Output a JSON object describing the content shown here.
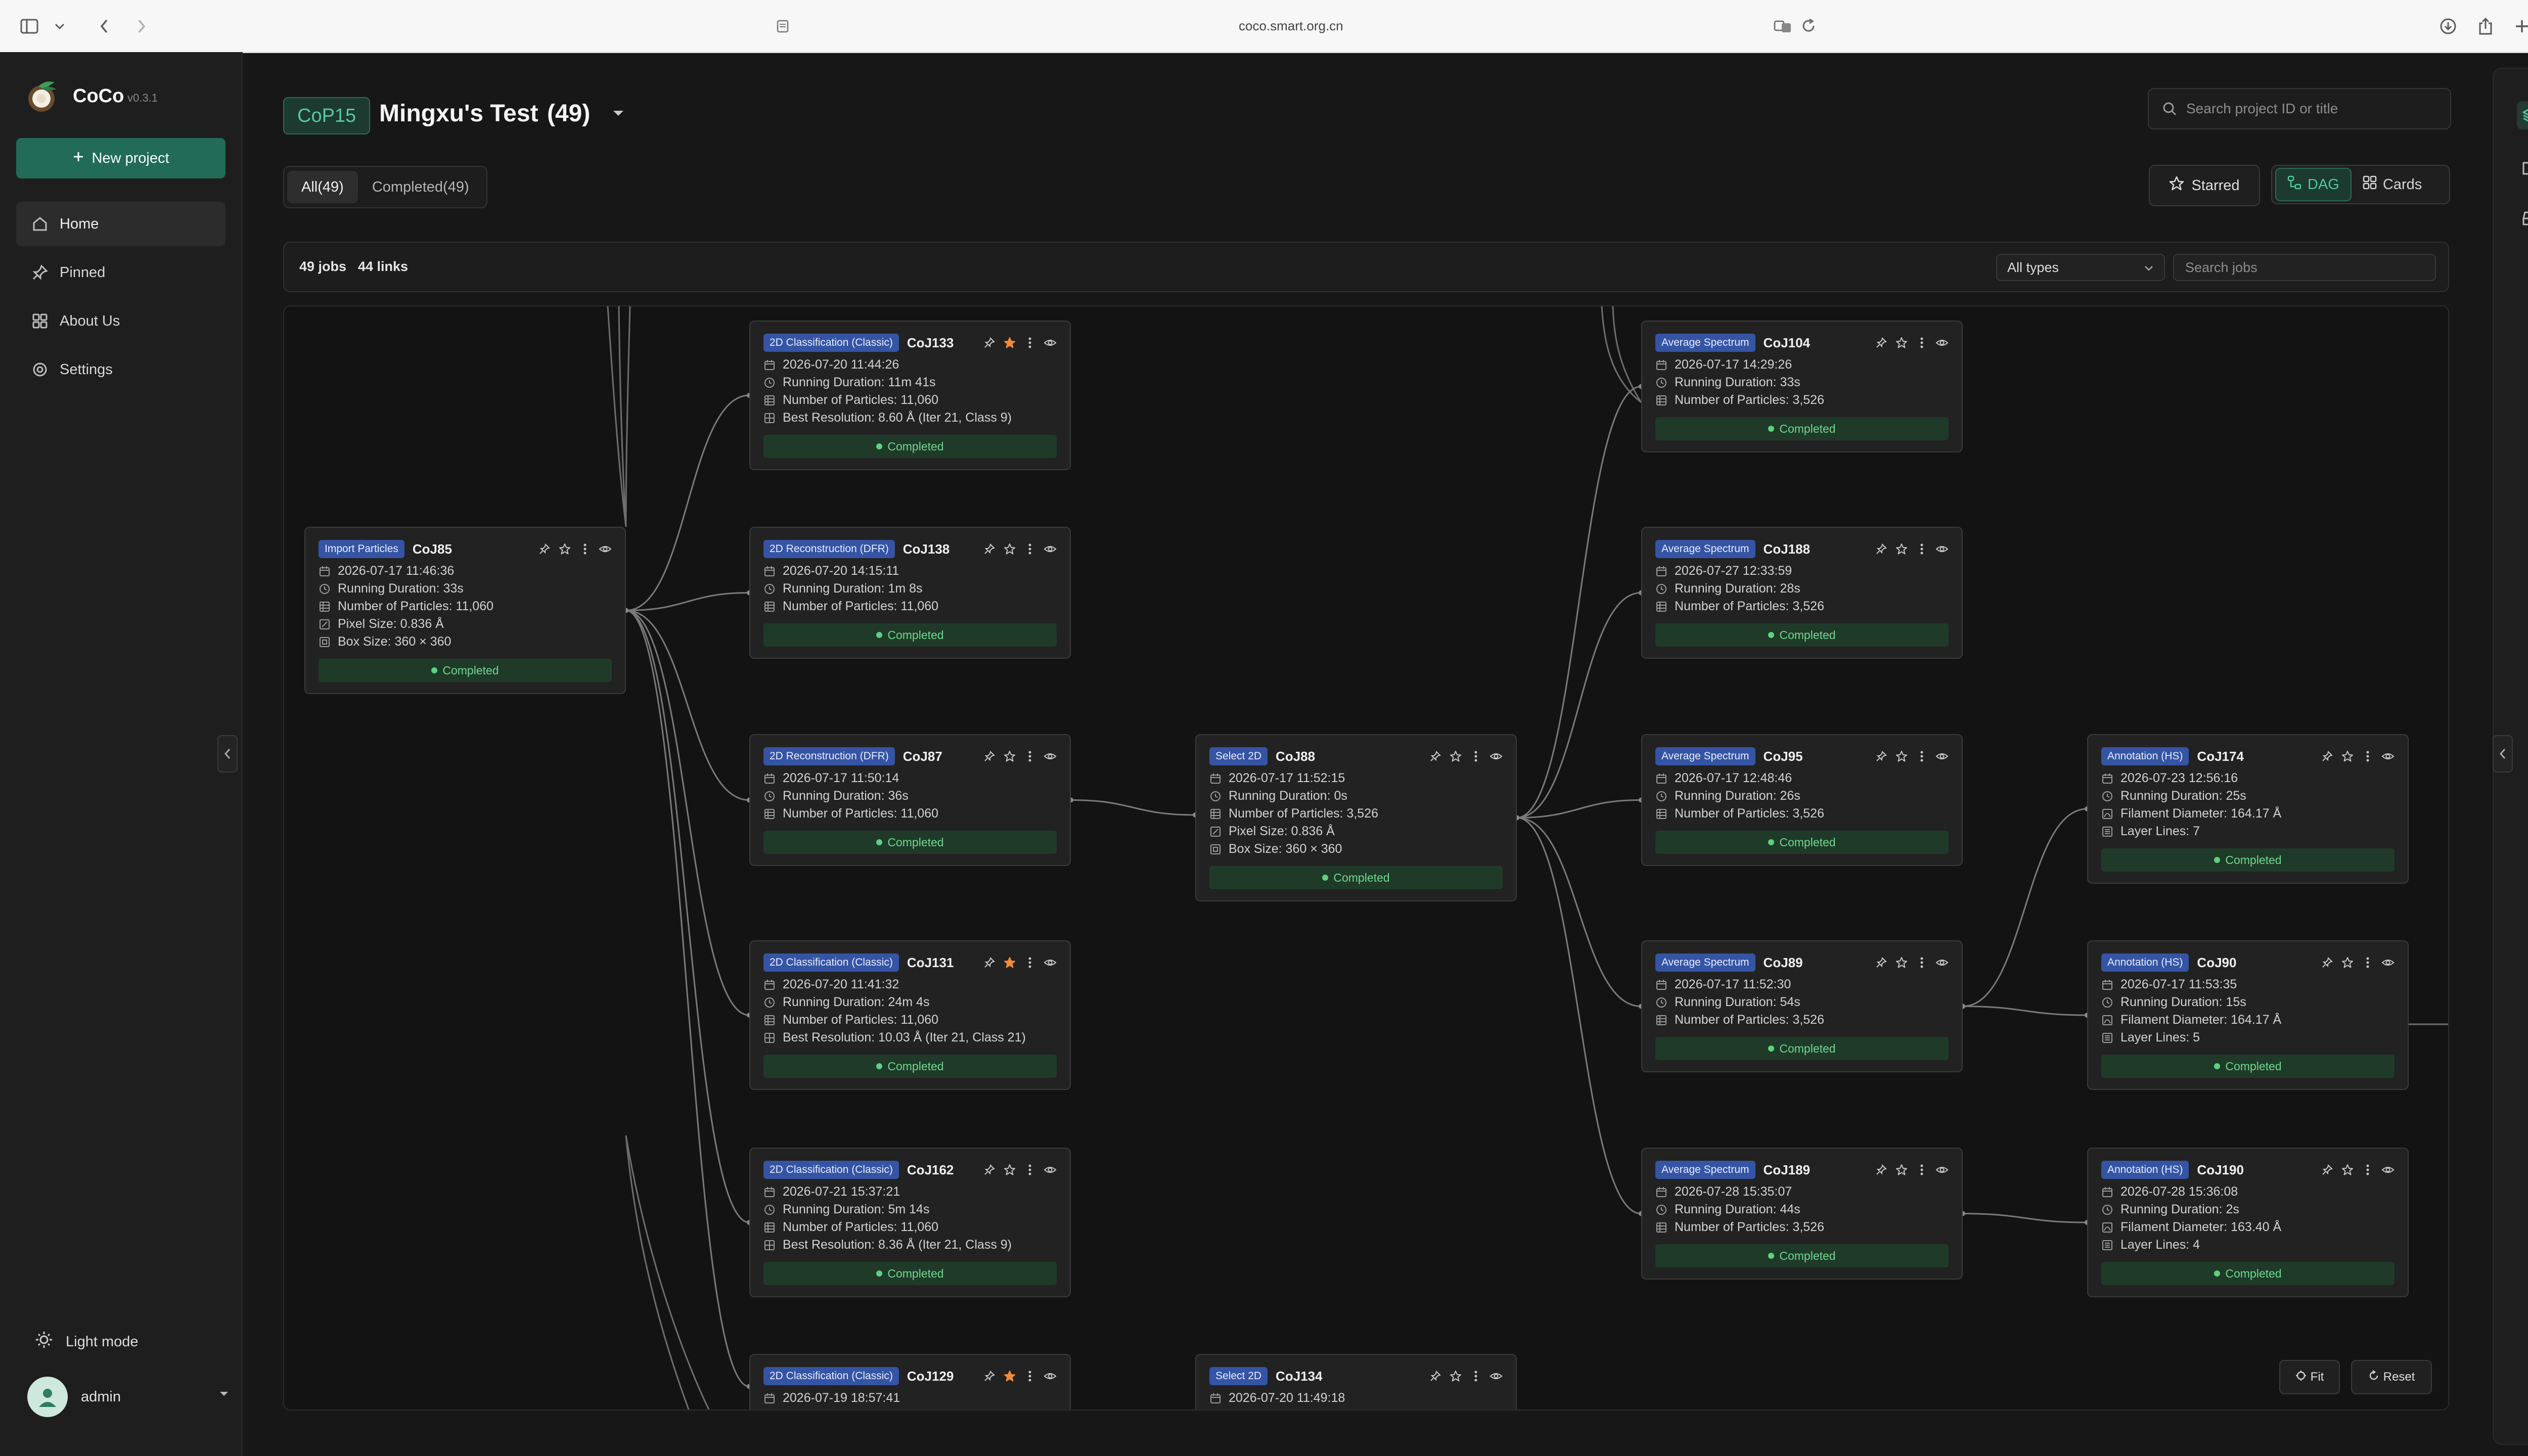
{
  "browser": {
    "url": "coco.smart.org.cn"
  },
  "sidebar": {
    "brand": "CoCo",
    "version": "v0.3.1",
    "new_project": "New project",
    "nav": [
      {
        "label": "Home",
        "icon": "home-icon",
        "active": true
      },
      {
        "label": "Pinned",
        "icon": "pin-icon",
        "active": false
      },
      {
        "label": "About Us",
        "icon": "grid-icon",
        "active": false
      },
      {
        "label": "Settings",
        "icon": "gear-icon",
        "active": false
      }
    ],
    "light_mode": "Light mode",
    "user": "admin"
  },
  "header": {
    "project_code": "CoP15",
    "project_title": "Mingxu's Test",
    "project_count": "(49)",
    "search_placeholder": "Search project ID or title",
    "tabs": [
      {
        "label": "All(49)",
        "active": true
      },
      {
        "label": "Completed(49)",
        "active": false
      }
    ],
    "starred": "Starred",
    "views": [
      {
        "label": "DAG",
        "active": true
      },
      {
        "label": "Cards",
        "active": false
      }
    ]
  },
  "toolbar": {
    "jobs": "49 jobs",
    "links": "44 links",
    "type_filter": "All types",
    "search_placeholder": "Search jobs"
  },
  "canvas": {
    "fit": "Fit",
    "reset": "Reset"
  },
  "colors": {
    "accent": "#226b57",
    "type_badge": "#3554a4",
    "status_green": "#6fd78f",
    "star_orange": "#f08a3c"
  },
  "nodes": [
    {
      "id": "CoJ85",
      "type": "Import Particles",
      "starred": false,
      "status": "Completed",
      "rows": [
        {
          "icon": "calendar-icon",
          "text": "2026-07-17 11:46:36"
        },
        {
          "icon": "clock-icon",
          "text": "Running Duration: 33s"
        },
        {
          "icon": "particles-icon",
          "text": "Number of Particles: 11,060"
        },
        {
          "icon": "ruler-icon",
          "text": "Pixel Size: 0.836 Å"
        },
        {
          "icon": "box-icon",
          "text": "Box Size: 360 × 360"
        }
      ]
    },
    {
      "id": "CoJ133",
      "type": "2D Classification (Classic)",
      "starred": true,
      "status": "Completed",
      "rows": [
        {
          "icon": "calendar-icon",
          "text": "2026-07-20 11:44:26"
        },
        {
          "icon": "clock-icon",
          "text": "Running Duration: 11m 41s"
        },
        {
          "icon": "particles-icon",
          "text": "Number of Particles: 11,060"
        },
        {
          "icon": "resolution-icon",
          "text": "Best Resolution: 8.60 Å (Iter 21, Class 9)"
        }
      ]
    },
    {
      "id": "CoJ138",
      "type": "2D Reconstruction (DFR)",
      "starred": false,
      "status": "Completed",
      "rows": [
        {
          "icon": "calendar-icon",
          "text": "2026-07-20 14:15:11"
        },
        {
          "icon": "clock-icon",
          "text": "Running Duration: 1m 8s"
        },
        {
          "icon": "particles-icon",
          "text": "Number of Particles: 11,060"
        }
      ]
    },
    {
      "id": "CoJ87",
      "type": "2D Reconstruction (DFR)",
      "starred": false,
      "status": "Completed",
      "rows": [
        {
          "icon": "calendar-icon",
          "text": "2026-07-17 11:50:14"
        },
        {
          "icon": "clock-icon",
          "text": "Running Duration: 36s"
        },
        {
          "icon": "particles-icon",
          "text": "Number of Particles: 11,060"
        }
      ]
    },
    {
      "id": "CoJ131",
      "type": "2D Classification (Classic)",
      "starred": true,
      "status": "Completed",
      "rows": [
        {
          "icon": "calendar-icon",
          "text": "2026-07-20 11:41:32"
        },
        {
          "icon": "clock-icon",
          "text": "Running Duration: 24m 4s"
        },
        {
          "icon": "particles-icon",
          "text": "Number of Particles: 11,060"
        },
        {
          "icon": "resolution-icon",
          "text": "Best Resolution: 10.03 Å (Iter 21, Class 21)"
        }
      ]
    },
    {
      "id": "CoJ162",
      "type": "2D Classification (Classic)",
      "starred": false,
      "status": "Completed",
      "rows": [
        {
          "icon": "calendar-icon",
          "text": "2026-07-21 15:37:21"
        },
        {
          "icon": "clock-icon",
          "text": "Running Duration: 5m 14s"
        },
        {
          "icon": "particles-icon",
          "text": "Number of Particles: 11,060"
        },
        {
          "icon": "resolution-icon",
          "text": "Best Resolution: 8.36 Å (Iter 21, Class 9)"
        }
      ]
    },
    {
      "id": "CoJ129",
      "type": "2D Classification (Classic)",
      "starred": true,
      "status": "",
      "rows": [
        {
          "icon": "calendar-icon",
          "text": "2026-07-19 18:57:41"
        }
      ]
    },
    {
      "id": "CoJ88",
      "type": "Select 2D",
      "starred": false,
      "status": "Completed",
      "rows": [
        {
          "icon": "calendar-icon",
          "text": "2026-07-17 11:52:15"
        },
        {
          "icon": "clock-icon",
          "text": "Running Duration: 0s"
        },
        {
          "icon": "particles-icon",
          "text": "Number of Particles: 3,526"
        },
        {
          "icon": "ruler-icon",
          "text": "Pixel Size: 0.836 Å"
        },
        {
          "icon": "box-icon",
          "text": "Box Size: 360 × 360"
        }
      ]
    },
    {
      "id": "CoJ134",
      "type": "Select 2D",
      "starred": false,
      "status": "",
      "rows": [
        {
          "icon": "calendar-icon",
          "text": "2026-07-20 11:49:18"
        }
      ]
    },
    {
      "id": "CoJ104",
      "type": "Average Spectrum",
      "starred": false,
      "status": "Completed",
      "rows": [
        {
          "icon": "calendar-icon",
          "text": "2026-07-17 14:29:26"
        },
        {
          "icon": "clock-icon",
          "text": "Running Duration: 33s"
        },
        {
          "icon": "particles-icon",
          "text": "Number of Particles: 3,526"
        }
      ]
    },
    {
      "id": "CoJ188",
      "type": "Average Spectrum",
      "starred": false,
      "status": "Completed",
      "rows": [
        {
          "icon": "calendar-icon",
          "text": "2026-07-27 12:33:59"
        },
        {
          "icon": "clock-icon",
          "text": "Running Duration: 28s"
        },
        {
          "icon": "particles-icon",
          "text": "Number of Particles: 3,526"
        }
      ]
    },
    {
      "id": "CoJ95",
      "type": "Average Spectrum",
      "starred": false,
      "status": "Completed",
      "rows": [
        {
          "icon": "calendar-icon",
          "text": "2026-07-17 12:48:46"
        },
        {
          "icon": "clock-icon",
          "text": "Running Duration: 26s"
        },
        {
          "icon": "particles-icon",
          "text": "Number of Particles: 3,526"
        }
      ]
    },
    {
      "id": "CoJ89",
      "type": "Average Spectrum",
      "starred": false,
      "status": "Completed",
      "rows": [
        {
          "icon": "calendar-icon",
          "text": "2026-07-17 11:52:30"
        },
        {
          "icon": "clock-icon",
          "text": "Running Duration: 54s"
        },
        {
          "icon": "particles-icon",
          "text": "Number of Particles: 3,526"
        }
      ]
    },
    {
      "id": "CoJ189",
      "type": "Average Spectrum",
      "starred": false,
      "status": "Completed",
      "rows": [
        {
          "icon": "calendar-icon",
          "text": "2026-07-28 15:35:07"
        },
        {
          "icon": "clock-icon",
          "text": "Running Duration: 44s"
        },
        {
          "icon": "particles-icon",
          "text": "Number of Particles: 3,526"
        }
      ]
    },
    {
      "id": "CoJ174",
      "type": "Annotation (HS)",
      "starred": false,
      "status": "Completed",
      "rows": [
        {
          "icon": "calendar-icon",
          "text": "2026-07-23 12:56:16"
        },
        {
          "icon": "clock-icon",
          "text": "Running Duration: 25s"
        },
        {
          "icon": "filament-icon",
          "text": "Filament Diameter: 164.17 Å"
        },
        {
          "icon": "layers-icon",
          "text": "Layer Lines: 7"
        }
      ]
    },
    {
      "id": "CoJ90",
      "type": "Annotation (HS)",
      "starred": false,
      "status": "Completed",
      "rows": [
        {
          "icon": "calendar-icon",
          "text": "2026-07-17 11:53:35"
        },
        {
          "icon": "clock-icon",
          "text": "Running Duration: 15s"
        },
        {
          "icon": "filament-icon",
          "text": "Filament Diameter: 164.17 Å"
        },
        {
          "icon": "layers-icon",
          "text": "Layer Lines: 5"
        }
      ]
    },
    {
      "id": "CoJ190",
      "type": "Annotation (HS)",
      "starred": false,
      "status": "Completed",
      "rows": [
        {
          "icon": "calendar-icon",
          "text": "2026-07-28 15:36:08"
        },
        {
          "icon": "clock-icon",
          "text": "Running Duration: 2s"
        },
        {
          "icon": "filament-icon",
          "text": "Filament Diameter: 163.40 Å"
        },
        {
          "icon": "layers-icon",
          "text": "Layer Lines: 4"
        }
      ]
    }
  ],
  "links": [
    [
      "CoJ85",
      "CoJ133"
    ],
    [
      "CoJ85",
      "CoJ138"
    ],
    [
      "CoJ85",
      "CoJ87"
    ],
    [
      "CoJ85",
      "CoJ131"
    ],
    [
      "CoJ85",
      "CoJ162"
    ],
    [
      "CoJ85",
      "CoJ129"
    ],
    [
      "CoJ87",
      "CoJ88"
    ],
    [
      "CoJ88",
      "CoJ104"
    ],
    [
      "CoJ88",
      "CoJ188"
    ],
    [
      "CoJ88",
      "CoJ95"
    ],
    [
      "CoJ88",
      "CoJ89"
    ],
    [
      "CoJ88",
      "CoJ189"
    ],
    [
      "CoJ89",
      "CoJ174"
    ],
    [
      "CoJ89",
      "CoJ90"
    ],
    [
      "CoJ189",
      "CoJ190"
    ]
  ]
}
